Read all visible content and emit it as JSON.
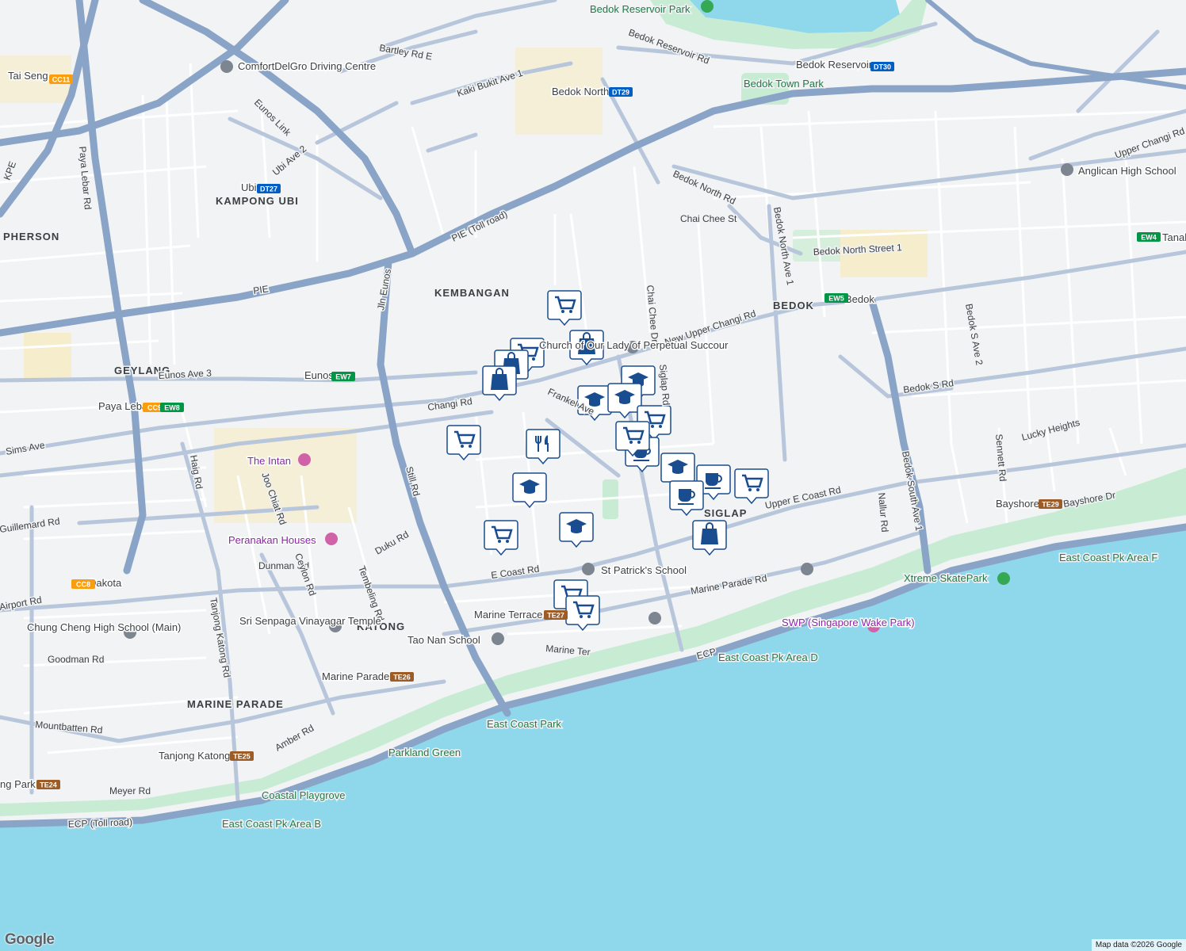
{
  "map": {
    "attribution": "Map data ©2026 Google",
    "logo": "Google",
    "colors": {
      "land": "#f1f3f4",
      "sea": "#8fd8ec",
      "park": "#c8ecd3",
      "highway": "#8aa4c8",
      "road": "#ffffff",
      "marker": "#1a4d8f",
      "mrt_green": "#009645",
      "mrt_blue": "#005ec4",
      "mrt_orange": "#fa9e0d",
      "mrt_brown": "#9d5b25"
    },
    "area_labels": [
      "KEMBANGAN",
      "GEYLANG",
      "KATONG",
      "MARINE PARADE",
      "KAMPONG UBI",
      "PHERSON",
      "BEDOK",
      "SIGLAP"
    ],
    "road_labels": [
      "PIE",
      "PIE (Toll road)",
      "KPE",
      "ECP",
      "ECP (Toll road)",
      "Changi Rd",
      "Sims Ave",
      "Frankel Ave",
      "New Upper Changi Rd",
      "Upper E Coast Rd",
      "E Coast Rd",
      "Marine Parade Rd",
      "Bedok North Rd",
      "Bedok S Rd",
      "Bedok South Ave 1",
      "Bedok North Ave 1",
      "Chai Chee St",
      "Bedok North Street 1",
      "Paya Lebar Rd",
      "Still Rd",
      "Haig Rd",
      "Guillemard Rd",
      "Dunman Rd",
      "Mountbatten Rd",
      "Tanjong Katong Rd",
      "Bartley Rd E",
      "Kaki Bukit Ave 1",
      "Ubi Ave 2",
      "Eunos Link",
      "Jln Eunos",
      "Bedok Reservoir Rd",
      "Upper Changi Rd",
      "Siglap Rd",
      "Chai Chee Dr",
      "Joo Chiat Rd",
      "Eunos Ave 3",
      "Airport Rd",
      "Goodman Rd",
      "Meyer Rd",
      "Amber Rd",
      "Marine Ter",
      "Tembeling Rd",
      "Duku Rd",
      "Ceylon Rd",
      "Lucky Heights",
      "Bayshore Dr",
      "Bedok S Ave 2",
      "Nallur Rd",
      "Sennett Rd"
    ],
    "mrt_stations": [
      {
        "name": "Tai Seng",
        "code": "CC11",
        "color": "#fa9e0d"
      },
      {
        "name": "Ubi",
        "code": "DT27",
        "color": "#005ec4"
      },
      {
        "name": "Bedok North",
        "code": "DT29",
        "color": "#005ec4"
      },
      {
        "name": "Bedok Reservoir",
        "code": "DT30",
        "color": "#005ec4"
      },
      {
        "name": "Eunos",
        "code": "EW7",
        "color": "#009645"
      },
      {
        "name": "Paya Lebar",
        "code": "CC9",
        "color": "#fa9e0d"
      },
      {
        "name": "",
        "code": "EW8",
        "color": "#009645"
      },
      {
        "name": "Bedok",
        "code": "EW5",
        "color": "#009645"
      },
      {
        "name": "Tanah",
        "code": "EW4",
        "color": "#009645"
      },
      {
        "name": "Dakota",
        "code": "CC8",
        "color": "#fa9e0d"
      },
      {
        "name": "Marine Terrace",
        "code": "TE27",
        "color": "#9d5b25"
      },
      {
        "name": "Marine Parade",
        "code": "TE26",
        "color": "#9d5b25"
      },
      {
        "name": "Tanjong Katong",
        "code": "TE25",
        "color": "#9d5b25"
      },
      {
        "name": "ng Park",
        "code": "TE24",
        "color": "#9d5b25"
      },
      {
        "name": "Bayshore",
        "code": "TE29",
        "color": "#9d5b25"
      }
    ],
    "places": [
      {
        "name": "Bedok Reservoir Park",
        "type": "park"
      },
      {
        "name": "Bedok Town Park",
        "type": "park"
      },
      {
        "name": "ComfortDelGro Driving Centre",
        "type": "poi"
      },
      {
        "name": "Anglican High School",
        "type": "school"
      },
      {
        "name": "The Intan",
        "type": "attraction"
      },
      {
        "name": "Peranakan Houses",
        "type": "attraction"
      },
      {
        "name": "Sri Senpaga Vinayagar Temple",
        "type": "worship"
      },
      {
        "name": "Chung Cheng High School (Main)",
        "type": "school"
      },
      {
        "name": "Tao Nan School",
        "type": "school"
      },
      {
        "name": "St Patrick's School",
        "type": "school"
      },
      {
        "name": "Church of Our Lady of Perpetual Succour",
        "type": "worship"
      },
      {
        "name": "Xtreme SkatePark",
        "type": "park"
      },
      {
        "name": "SWP (Singapore Wake Park)",
        "type": "attraction"
      },
      {
        "name": "East Coast Park",
        "type": "park"
      },
      {
        "name": "East Coast Pk Area D",
        "type": "park"
      },
      {
        "name": "East Coast Pk Area F",
        "type": "park"
      },
      {
        "name": "East Coast Pk Area B",
        "type": "park"
      },
      {
        "name": "Parkland Green",
        "type": "park"
      },
      {
        "name": "Coastal Playgrove",
        "type": "park"
      }
    ],
    "markers": [
      {
        "icon": "cart-icon"
      },
      {
        "icon": "bag-icon"
      },
      {
        "icon": "cart-icon"
      },
      {
        "icon": "bag-icon"
      },
      {
        "icon": "bag-icon"
      },
      {
        "icon": "cart-icon"
      },
      {
        "icon": "school-icon"
      },
      {
        "icon": "school-icon"
      },
      {
        "icon": "school-icon"
      },
      {
        "icon": "cart-icon"
      },
      {
        "icon": "coffee-icon"
      },
      {
        "icon": "cart-icon"
      },
      {
        "icon": "fork-knife-icon"
      },
      {
        "icon": "school-icon"
      },
      {
        "icon": "school-icon"
      },
      {
        "icon": "cart-icon"
      },
      {
        "icon": "school-icon"
      },
      {
        "icon": "coffee-icon"
      },
      {
        "icon": "coffee-icon"
      },
      {
        "icon": "cart-icon"
      },
      {
        "icon": "bag-icon"
      },
      {
        "icon": "cart-icon"
      },
      {
        "icon": "cart-icon"
      }
    ]
  }
}
